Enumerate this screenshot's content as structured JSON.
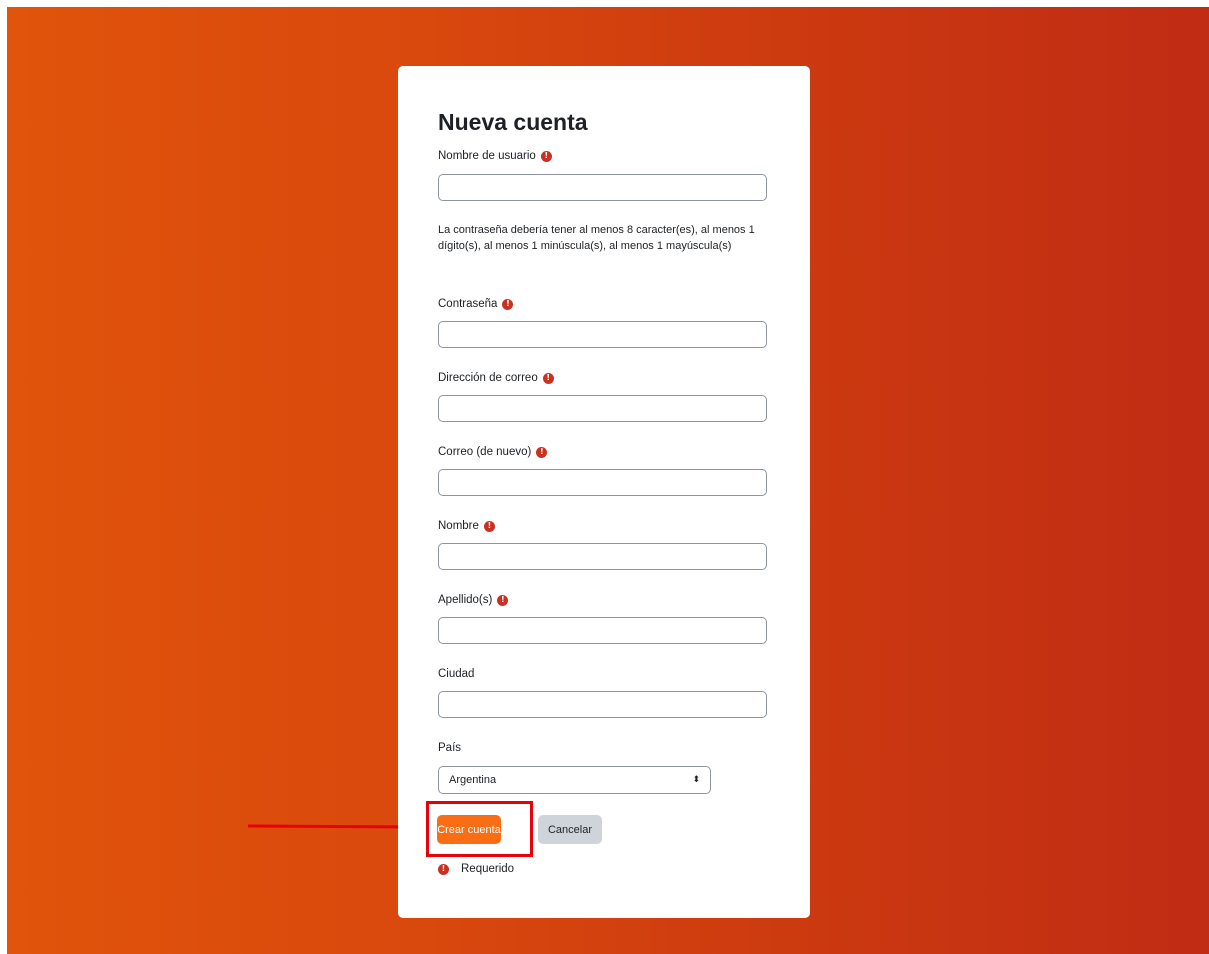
{
  "form": {
    "title": "Nueva cuenta",
    "username_label": "Nombre de usuario",
    "password_hint": "La contraseña debería tener al menos 8 caracter(es), al menos 1 dígito(s), al menos 1 minúscula(s), al menos 1 mayúscula(s)",
    "password_label": "Contraseña",
    "email_label": "Dirección de correo",
    "email_again_label": "Correo (de nuevo)",
    "firstname_label": "Nombre",
    "lastname_label": "Apellido(s)",
    "city_label": "Ciudad",
    "country_label": "País",
    "country_value": "Argentina",
    "submit_label": "Crear cuenta",
    "cancel_label": "Cancelar",
    "required_legend": "Requerido",
    "required_icon": "!"
  },
  "colors": {
    "background_start": "#e0540b",
    "background_end": "#c02c14",
    "primary_button": "#f96e15",
    "secondary_button": "#ced4da",
    "required_icon": "#ca3120",
    "annotation": "#e8000b"
  }
}
